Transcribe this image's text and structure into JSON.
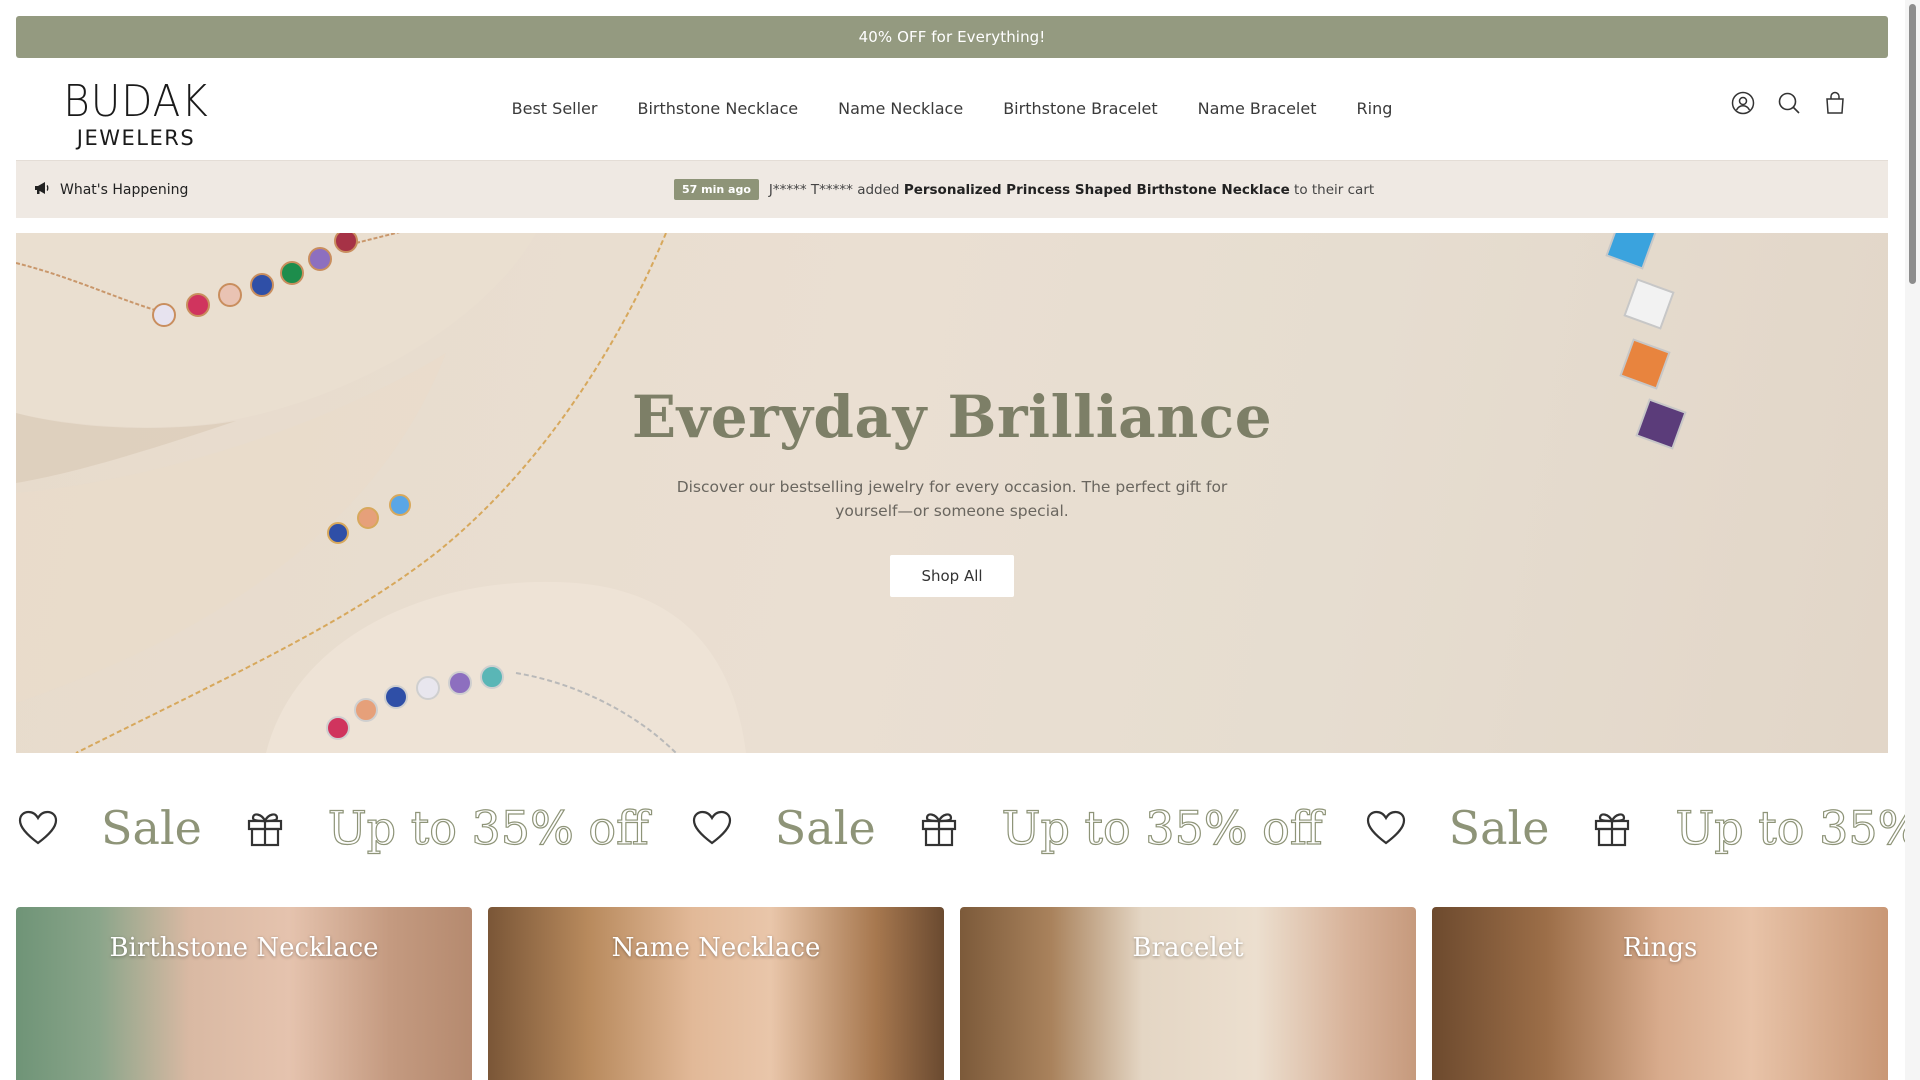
{
  "announcement": {
    "text": "40% OFF for Everything!"
  },
  "header": {
    "logo": {
      "line1": "BUDAK",
      "line2": "JEWELERS"
    },
    "nav": [
      {
        "label": "Best Seller"
      },
      {
        "label": "Birthstone Necklace"
      },
      {
        "label": "Name Necklace"
      },
      {
        "label": "Birthstone Bracelet"
      },
      {
        "label": "Name Bracelet"
      },
      {
        "label": "Ring"
      }
    ],
    "icons": [
      "account-icon",
      "search-icon",
      "bag-icon"
    ]
  },
  "ticker": {
    "label": "What's Happening",
    "time": "57 min ago",
    "user": "J***** T*****",
    "verb": "added",
    "product": "Personalized Princess Shaped Birthstone Necklace",
    "suffix": "to their cart"
  },
  "hero": {
    "title": "Everyday Brilliance",
    "subtitle": "Discover our bestselling jewelry for every occasion. The perfect gift for yourself—or someone special.",
    "button": "Shop All"
  },
  "marquee": {
    "partial": "f",
    "sale": "Sale",
    "off": "Up to 35% off",
    "icons": [
      "heart-icon",
      "gift-icon"
    ]
  },
  "categories": [
    {
      "label": "Birthstone Necklace"
    },
    {
      "label": "Name Necklace"
    },
    {
      "label": "Bracelet"
    },
    {
      "label": "Rings"
    }
  ],
  "colors": {
    "accent": "#949a80",
    "ticker_bg": "#efe9e3",
    "hero_title": "#7d7f67"
  }
}
